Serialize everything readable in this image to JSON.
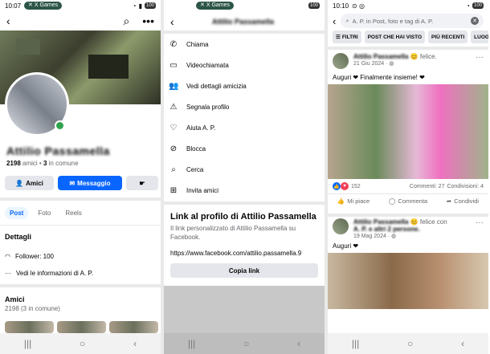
{
  "status_bars": [
    {
      "time": "10:07",
      "pill": "X Games",
      "battery": "100"
    },
    {
      "time": "",
      "pill": "X Games",
      "battery": "100"
    },
    {
      "time": "10:10",
      "pill": "",
      "battery": "100"
    }
  ],
  "profile": {
    "name": "Attilio Passamella",
    "friends_count": "2198",
    "friends_word": "amici",
    "common_count": "3",
    "common_word": "in comune",
    "buttons": {
      "friends": "Amici",
      "message": "Messaggio"
    },
    "tabs": [
      "Post",
      "Foto",
      "Reels"
    ],
    "details_title": "Dettagli",
    "followers": "Follower: 100",
    "see_info": "Vedi le informazioni di A. P.",
    "friends_title": "Amici",
    "friends_sub": "2198 (3 in comune)"
  },
  "menu": {
    "title": "Attilio Passamella",
    "items": [
      {
        "icon": "phone-icon",
        "label": "Chiama"
      },
      {
        "icon": "video-icon",
        "label": "Videochiamata"
      },
      {
        "icon": "friends-icon",
        "label": "Vedi dettagli amicizia"
      },
      {
        "icon": "report-icon",
        "label": "Segnala profilo"
      },
      {
        "icon": "support-icon",
        "label": "Aiuta A. P."
      },
      {
        "icon": "block-icon",
        "label": "Blocca"
      },
      {
        "icon": "search-icon",
        "label": "Cerca"
      },
      {
        "icon": "invite-icon",
        "label": "Invita amici"
      }
    ],
    "link_title": "Link al profilo di Attilio Passamella",
    "link_desc": "Il link personalizzato di Attilio Passamella su Facebook.",
    "link_url": "https://www.facebook.com/attilio.passamella.9",
    "copy_label": "Copia link"
  },
  "search": {
    "query": "A. P. in Post, foto e tag di A. P.",
    "chips": [
      "FILTRI",
      "POST CHE HAI VISTO",
      "PIÙ RECENTI",
      "LUOGO T"
    ]
  },
  "posts": [
    {
      "author": "Attilio Passamella",
      "feeling": "😊 felice.",
      "date": "21 Giu 2024 · ",
      "text": "Auguri ❤ Finalmente insieme! ❤",
      "reactions": "152",
      "comments": "Commenti: 27",
      "shares": "Condivisioni: 4"
    },
    {
      "author": "Attilio Passamella",
      "feeling": "😊 felice con",
      "with": "A. P. e altri 2 persone.",
      "date": "19 Mag 2024 · ",
      "text": "Auguri ❤"
    }
  ],
  "actions": {
    "like": "Mi piace",
    "comment": "Commenta",
    "share": "Condividi"
  }
}
